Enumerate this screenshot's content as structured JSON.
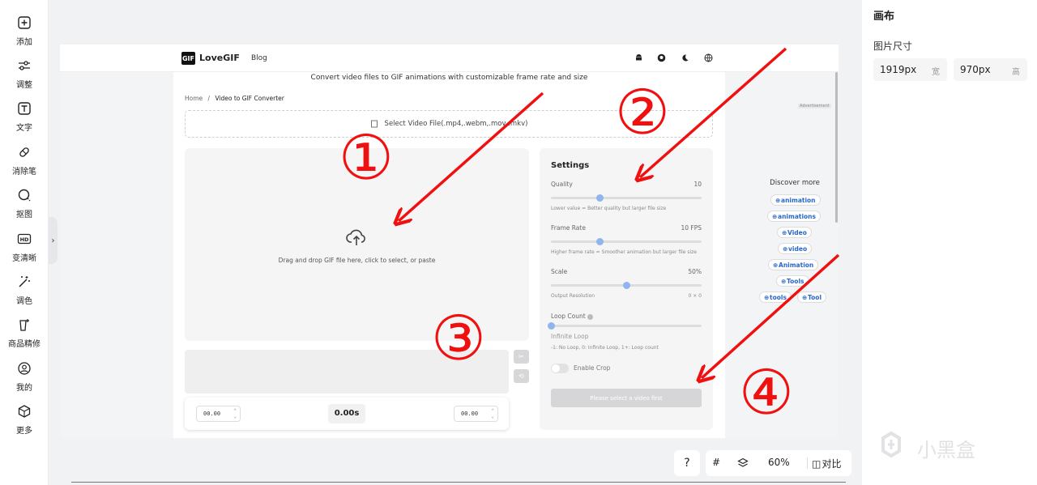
{
  "left_toolbar": {
    "items": [
      {
        "label": "添加",
        "icon": "plus-square-icon"
      },
      {
        "label": "调整",
        "icon": "sliders-icon"
      },
      {
        "label": "文字",
        "icon": "text-icon"
      },
      {
        "label": "消除笔",
        "icon": "eraser-icon"
      },
      {
        "label": "抠图",
        "icon": "cutout-icon"
      },
      {
        "label": "变清晰",
        "icon": "hd-icon"
      },
      {
        "label": "调色",
        "icon": "magic-wand-icon"
      },
      {
        "label": "商品精修",
        "icon": "product-retouch-icon"
      },
      {
        "label": "我的",
        "icon": "user-icon"
      },
      {
        "label": "更多",
        "icon": "cube-icon"
      }
    ],
    "collapse_glyph": "›"
  },
  "lovegif": {
    "logo_text": "GIF",
    "brand": "LoveGIF",
    "blog": "Blog",
    "header_icons": [
      "android-icon",
      "github-icon",
      "moon-icon",
      "globe-icon"
    ],
    "subtitle": "Convert video files to GIF animations with customizable frame rate and size",
    "breadcrumb": {
      "home": "Home",
      "sep": "/",
      "current": "Video to GIF Converter"
    },
    "select_file": "Select Video File(.mp4,.webm,.mov,.mkv)",
    "drop_text": "Drag and drop GIF file here, click to select, or paste",
    "timeline_buttons": [
      "✂",
      "⟲"
    ],
    "time_start": "00.00",
    "time_center": "0.00s",
    "time_end": "00.00",
    "settings": {
      "title": "Settings",
      "quality_label": "Quality",
      "quality_value": "10",
      "quality_level": 0.32,
      "quality_hint": "Lower value = Better quality but larger file size",
      "fps_label": "Frame Rate",
      "fps_value": "10 FPS",
      "fps_level": 0.32,
      "fps_hint": "Higher frame rate = Smoother animation but larger file size",
      "scale_label": "Scale",
      "scale_value": "50%",
      "scale_level": 0.5,
      "scale_hint": "Output Resolution",
      "scale_hint_value": "0 × 0",
      "loop_label": "Loop Count",
      "loop_level": 0.0,
      "loop_sub": "Infinite Loop",
      "loop_hint": "-1: No Loop, 0: Infinite Loop, 1+: Loop count",
      "crop_label": "Enable Crop",
      "button": "Please select a video first"
    },
    "advertisement": "Advertisement",
    "discover_title": "Discover more",
    "discover_items": [
      "animation",
      "animations",
      "Video",
      "video",
      "Animation",
      "Tools",
      "tools",
      "Tool"
    ]
  },
  "annotations": {
    "color": "#f01010",
    "labels": [
      "①",
      "②",
      "③",
      "④"
    ]
  },
  "bottom_bar": {
    "help": "?",
    "grid_icon": "grid-icon",
    "layers_icon": "layers-icon",
    "zoom": "60%",
    "compare_icon": "compare-icon",
    "compare": "对比"
  },
  "right_panel": {
    "title": "画布",
    "size_label": "图片尺寸",
    "width_value": "1919px",
    "width_unit": "宽",
    "height_value": "970px",
    "height_unit": "高"
  },
  "watermark": "小黑盒"
}
